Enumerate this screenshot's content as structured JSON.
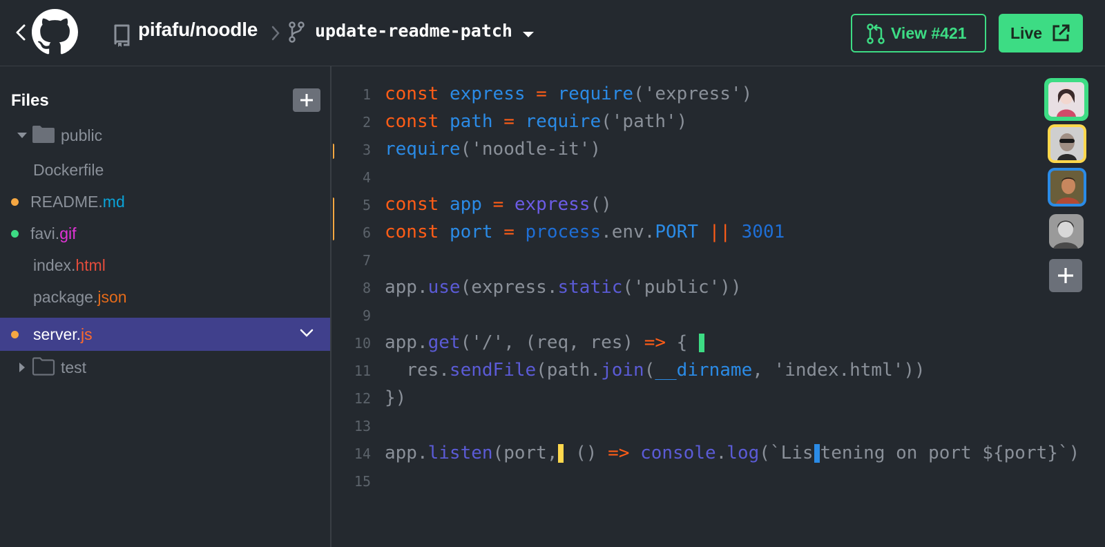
{
  "header": {
    "repo": "pifafu/noodle",
    "branch": "update-readme-patch",
    "view_button": "View #421",
    "live_button": "Live"
  },
  "sidebar": {
    "title": "Files",
    "items": [
      {
        "base": "public",
        "ext": "",
        "type": "folder",
        "expanded": true
      },
      {
        "base": "Dockerfile",
        "ext": "",
        "type": "file"
      },
      {
        "base": "README.",
        "ext": "md",
        "type": "file",
        "status": "modified"
      },
      {
        "base": "favi.",
        "ext": "gif",
        "type": "file",
        "status": "added"
      },
      {
        "base": "index.",
        "ext": "html",
        "type": "file"
      },
      {
        "base": "package.",
        "ext": "json",
        "type": "file"
      },
      {
        "base": "server.",
        "ext": "js",
        "type": "file",
        "status": "modified",
        "selected": true
      },
      {
        "base": "test",
        "ext": "",
        "type": "folder",
        "expanded": false
      }
    ]
  },
  "editor": {
    "line_numbers": [
      "1",
      "2",
      "3",
      "4",
      "5",
      "6",
      "7",
      "8",
      "9",
      "10",
      "11",
      "12",
      "13",
      "14",
      "15"
    ],
    "tokens": {
      "l1": [
        "const",
        " ",
        "express",
        " ",
        "=",
        " ",
        "require",
        "('express')"
      ],
      "l2": [
        "const",
        " ",
        "path",
        " ",
        "=",
        " ",
        "require",
        "('path')"
      ],
      "l3": [
        "require",
        "('noodle-it')"
      ],
      "l5": [
        "const",
        " ",
        "app",
        " ",
        "=",
        " ",
        "express",
        "()"
      ],
      "l6": [
        "const",
        " ",
        "port",
        " ",
        "=",
        " ",
        "process",
        ".env.",
        "PORT",
        " ",
        "||",
        " ",
        "3001"
      ],
      "l8": [
        "app.",
        "use",
        "(express.",
        "static",
        "('public'))"
      ],
      "l10": [
        "app.",
        "get",
        "('/', (req, res) ",
        "=>",
        " { "
      ],
      "l11": [
        "  res.",
        "sendFile",
        "(path.",
        "join",
        "(",
        "__dirname",
        ", 'index.html'))"
      ],
      "l12": [
        "})"
      ],
      "l14a": [
        "app.",
        "listen",
        "(port,"
      ],
      "l14b": [
        " () ",
        "=>",
        " ",
        "console",
        ".",
        "log",
        "(`Lis"
      ],
      "l14c": [
        "tening on port ${port}`)"
      ]
    }
  },
  "colors": {
    "accent_green": "#3ddc84",
    "modified_orange": "#f5a742",
    "selection_purple": "#40408c",
    "keyword": "#ff5d17",
    "variable": "#2b8be6",
    "function": "#6c5ce7"
  },
  "icons": [
    "back-chevron-icon",
    "github-logo-icon",
    "repo-icon",
    "branch-icon",
    "caret-down-icon",
    "pull-request-icon",
    "external-link-icon",
    "plus-icon",
    "folder-icon"
  ]
}
